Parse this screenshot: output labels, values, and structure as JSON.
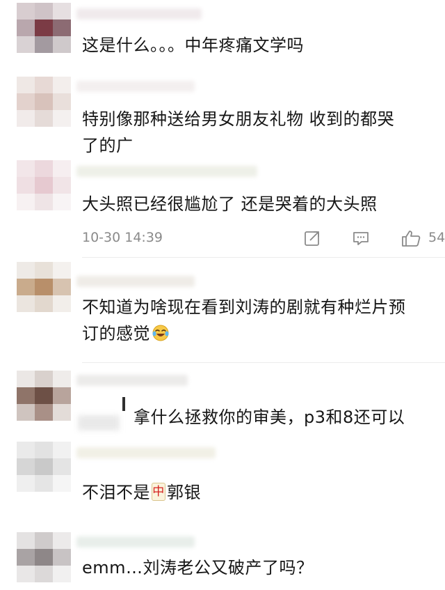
{
  "comments": [
    {
      "id": 1,
      "lines": [
        "这是什么。。。中年疼痛文学吗"
      ]
    },
    {
      "id": 2,
      "lines": [
        "特别像那种送给男女朋友礼物 收到的都哭",
        "了的广"
      ]
    },
    {
      "id": 3,
      "lines": [
        "大头照已经很尴尬了 还是哭着的大头照"
      ]
    },
    {
      "id": 4,
      "lines": [
        "不知道为啥现在看到刘涛的剧就有种烂片预",
        "订的感觉"
      ],
      "emoji": "laughing-crying-emoji"
    },
    {
      "id": 5,
      "lines": [
        "拿什么拯救你的审美，p3和8还可以"
      ]
    },
    {
      "id": 6,
      "prefix": "不泪不是",
      "tile_char": "中",
      "suffix": "郭银"
    },
    {
      "id": 7,
      "lines": [
        "emm…刘涛老公又破产了吗？"
      ]
    }
  ],
  "meta": {
    "time": "10-30 14:39",
    "like_count": "54",
    "share_icon": "share-icon",
    "comment_icon": "comment-icon",
    "like_icon": "thumbs-up-icon"
  },
  "colors": {
    "text": "#161616",
    "meta": "#8a8a8a",
    "tile_red": "#d4201f"
  }
}
